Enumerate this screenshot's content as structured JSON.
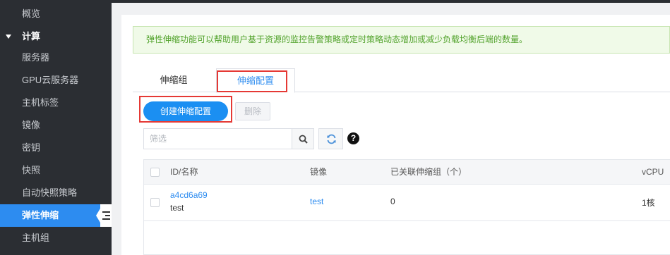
{
  "sidebar": {
    "items": [
      {
        "label": "概览"
      },
      {
        "label": "计算"
      },
      {
        "label": "服务器"
      },
      {
        "label": "GPU云服务器"
      },
      {
        "label": "主机标签"
      },
      {
        "label": "镜像"
      },
      {
        "label": "密钥"
      },
      {
        "label": "快照"
      },
      {
        "label": "自动快照策略"
      },
      {
        "label": "弹性伸缩"
      },
      {
        "label": "主机组"
      }
    ],
    "active_item": "弹性伸缩",
    "collapse_icon": "collapse-menu-icon"
  },
  "notice": {
    "text": "弹性伸缩功能可以帮助用户基于资源的监控告警策略或定时策略动态增加或减少负载均衡后端的数量。"
  },
  "tabs": [
    {
      "label": "伸缩组"
    },
    {
      "label": "伸缩配置"
    }
  ],
  "active_tab": "伸缩配置",
  "toolbar": {
    "create_label": "创建伸缩配置",
    "delete_label": "删除",
    "search_placeholder": "筛选",
    "search_icon": "search-icon",
    "refresh_icon": "refresh-icon",
    "help_label": "?"
  },
  "table": {
    "headers": {
      "id_name": "ID/名称",
      "image": "镜像",
      "groups": "已关联伸缩组（个）",
      "vcpu": "vCPU"
    },
    "rows": [
      {
        "id": "a4cd6a69",
        "name": "test",
        "image": "test",
        "groups": "0",
        "vcpu": "1核"
      }
    ]
  },
  "colors": {
    "accent": "#2d8cf0",
    "sidebar_bg": "#2b2e33",
    "highlight": "#e53935",
    "notice_text": "#52a32c"
  }
}
